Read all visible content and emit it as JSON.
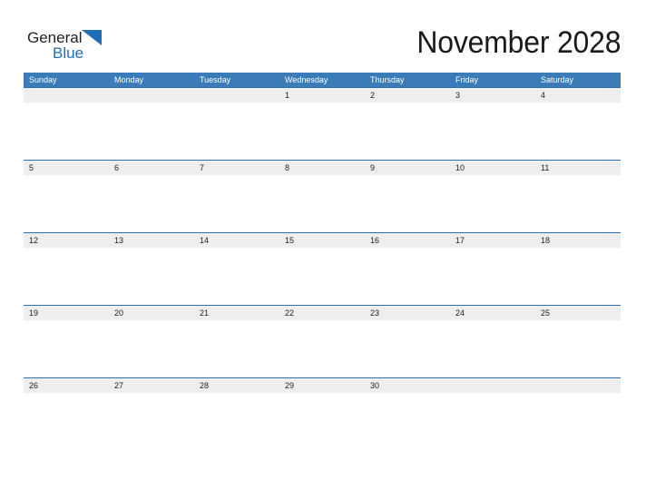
{
  "brand": {
    "name_top": "General",
    "name_bottom": "Blue",
    "color_text": "#231f20",
    "color_blue": "#1f6eb5"
  },
  "header": {
    "title": "November 2028",
    "month": "November",
    "year": "2028"
  },
  "theme": {
    "header_blue": "#3b7cb8",
    "row_border_blue": "#2f6fa8",
    "band_gray": "#eeeeee",
    "page_background": "#ffffff",
    "date_text": "#222222",
    "weekday_text": "#ffffff"
  },
  "calendar": {
    "weekdays": [
      "Sunday",
      "Monday",
      "Tuesday",
      "Wednesday",
      "Thursday",
      "Friday",
      "Saturday"
    ],
    "weeks": [
      [
        "",
        "",
        "",
        "1",
        "2",
        "3",
        "4"
      ],
      [
        "5",
        "6",
        "7",
        "8",
        "9",
        "10",
        "11"
      ],
      [
        "12",
        "13",
        "14",
        "15",
        "16",
        "17",
        "18"
      ],
      [
        "19",
        "20",
        "21",
        "22",
        "23",
        "24",
        "25"
      ],
      [
        "26",
        "27",
        "28",
        "29",
        "30",
        "",
        ""
      ]
    ]
  }
}
